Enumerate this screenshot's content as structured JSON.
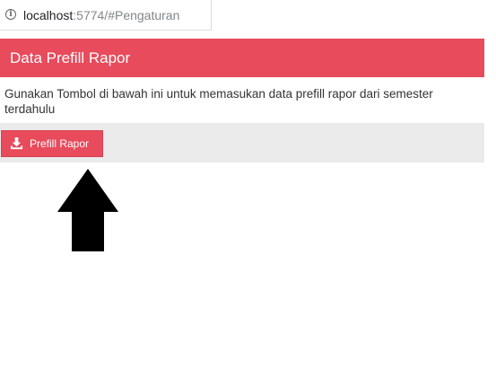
{
  "browser": {
    "url_host": "localhost",
    "url_rest": ":5774/#Pengaturan",
    "info_icon": "info-icon"
  },
  "panel": {
    "title": "Data Prefill Rapor",
    "description": "Gunakan Tombol di bawah ini untuk memasukan data prefill rapor dari semester terdahulu",
    "button_label": "Prefill Rapor",
    "button_icon": "download-icon"
  },
  "annotation": {
    "icon": "up-arrow-icon"
  },
  "colors": {
    "accent": "#e74b5c",
    "footer_bg": "#ebebeb",
    "text": "#333333"
  }
}
